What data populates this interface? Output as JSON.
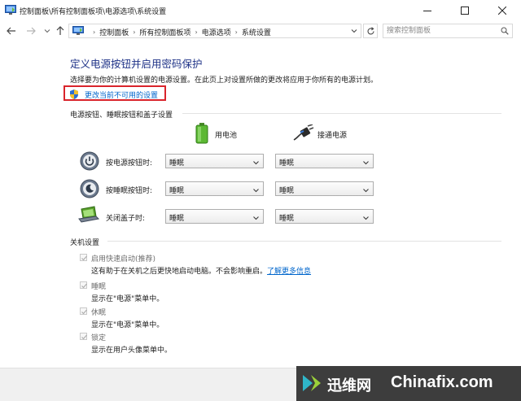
{
  "window": {
    "title": "控制面板\\所有控制面板项\\电源选项\\系统设置",
    "icon": "control-panel-icon"
  },
  "nav": {
    "breadcrumbs": [
      "控制面板",
      "所有控制面板项",
      "电源选项",
      "系统设置"
    ],
    "search_placeholder": "搜索控制面板"
  },
  "page": {
    "title": "定义电源按钮并启用密码保护",
    "description": "选择要为你的计算机设置的电源设置。在此页上对设置所做的更改将应用于你所有的电源计划。",
    "change_link": "更改当前不可用的设置"
  },
  "buttons_section": {
    "title": "电源按钮、睡眠按钮和盖子设置",
    "col_battery": "用电池",
    "col_plugged": "接通电源",
    "rows": [
      {
        "label": "按电源按钮时:",
        "battery": "睡眠",
        "plugged": "睡眠",
        "icon": "power-button-icon"
      },
      {
        "label": "按睡眠按钮时:",
        "battery": "睡眠",
        "plugged": "睡眠",
        "icon": "sleep-button-icon"
      },
      {
        "label": "关闭盖子时:",
        "battery": "睡眠",
        "plugged": "睡眠",
        "icon": "laptop-lid-icon"
      }
    ]
  },
  "shutdown_section": {
    "title": "关机设置",
    "options": [
      {
        "label": "启用快速启动(推荐)",
        "desc": "这有助于在关机之后更快地启动电脑。不会影响重启。",
        "link": "了解更多信息",
        "checked": true
      },
      {
        "label": "睡眠",
        "desc": "显示在\"电源\"菜单中。",
        "checked": true
      },
      {
        "label": "休眠",
        "desc": "显示在\"电源\"菜单中。",
        "checked": true
      },
      {
        "label": "锁定",
        "desc": "显示在用户头像菜单中。",
        "checked": true
      }
    ]
  },
  "watermark": {
    "cn": "迅维网",
    "en": "Chinafix.com"
  },
  "colors": {
    "title_blue": "#1e3287",
    "link_blue": "#0066cc",
    "highlight_red": "#d9242b"
  }
}
